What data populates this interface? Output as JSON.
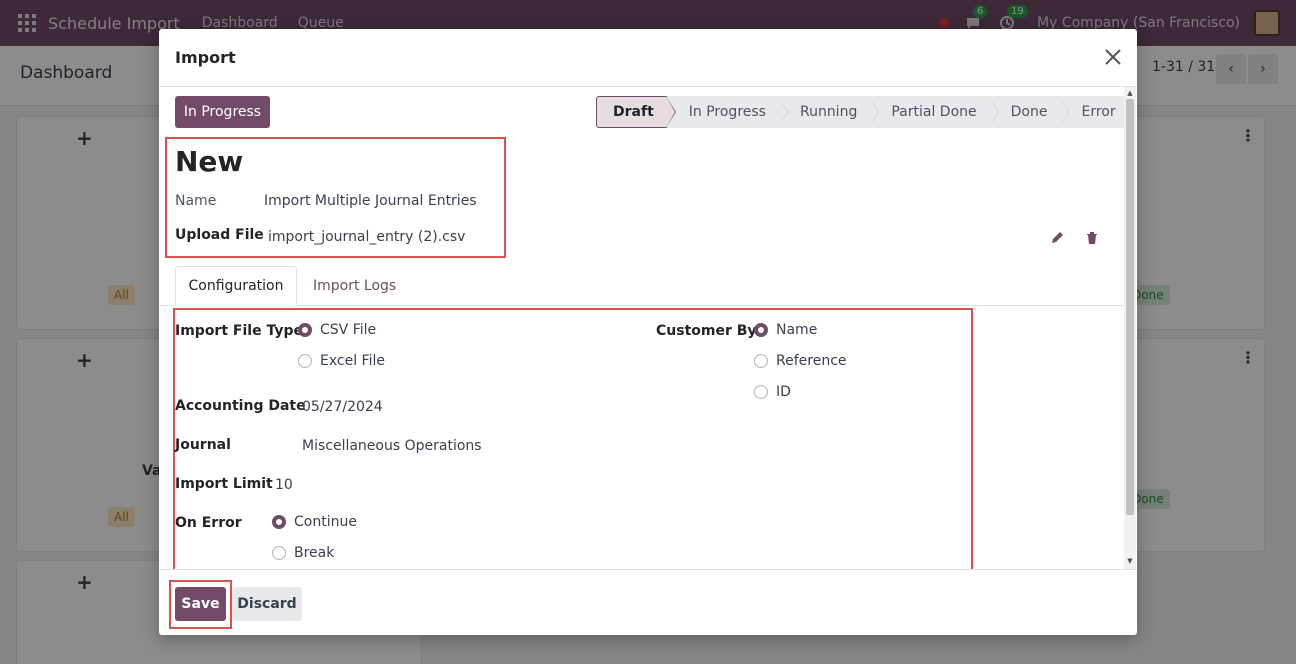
{
  "navbar": {
    "app_name": "Schedule Import",
    "menu": [
      "Dashboard",
      "Queue"
    ],
    "chat_count": "6",
    "activity_count": "19",
    "company": "My Company (San Francisco)"
  },
  "control_panel": {
    "breadcrumb": "Dashboard",
    "pager": "1-31 / 31"
  },
  "background": {
    "tag_all": "All",
    "tag_done": "Done",
    "partial_text": "Va"
  },
  "modal": {
    "title": "Import",
    "status_button": "In Progress",
    "stages": [
      "Draft",
      "In Progress",
      "Running",
      "Partial Done",
      "Done",
      "Error"
    ],
    "active_stage": "Draft",
    "record_title": "New",
    "name_label": "Name",
    "name_value": "Import Multiple Journal Entries",
    "upload_label": "Upload File",
    "upload_value": "import_journal_entry (2).csv",
    "tabs": [
      "Configuration",
      "Import Logs"
    ],
    "fields": {
      "file_type_label": "Import File Type",
      "file_type_options": [
        "CSV File",
        "Excel File"
      ],
      "file_type_selected": "CSV File",
      "customer_by_label": "Customer By",
      "customer_by_options": [
        "Name",
        "Reference",
        "ID"
      ],
      "customer_by_selected": "Name",
      "accounting_date_label": "Accounting Date",
      "accounting_date_value": "05/27/2024",
      "journal_label": "Journal",
      "journal_value": "Miscellaneous Operations",
      "import_limit_label": "Import Limit",
      "import_limit_value": "10",
      "on_error_label": "On Error",
      "on_error_options": [
        "Continue",
        "Break"
      ],
      "on_error_selected": "Continue"
    },
    "save_label": "Save",
    "discard_label": "Discard"
  },
  "colors": {
    "brand": "#714b67",
    "annotation": "#d9534f"
  }
}
